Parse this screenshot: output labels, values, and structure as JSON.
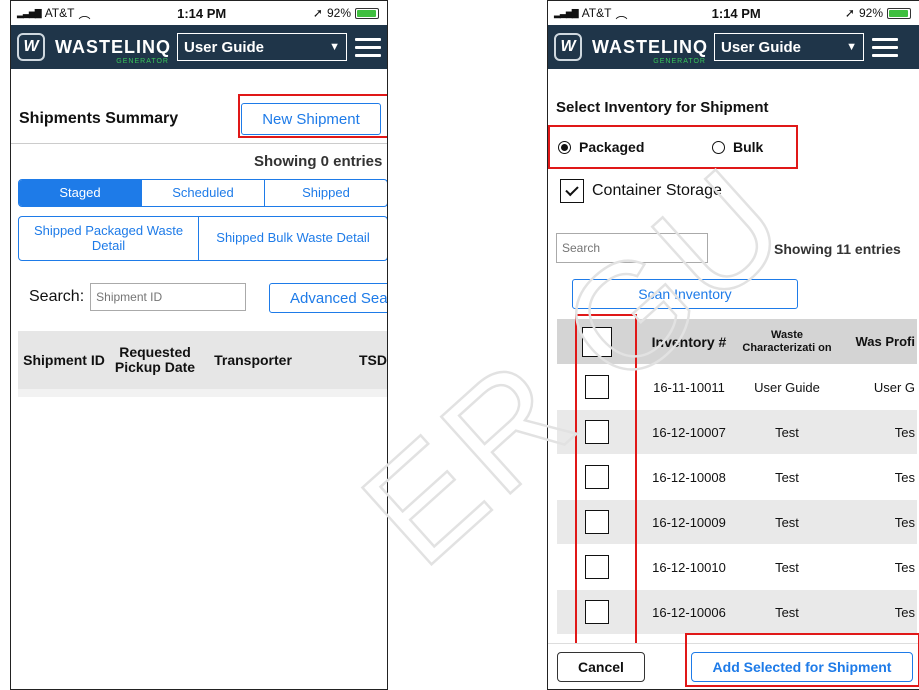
{
  "status_bar": {
    "carrier": "AT&T",
    "time": "1:14 PM",
    "battery": "92%"
  },
  "app_bar": {
    "logo": "W",
    "brand": "WASTELINQ",
    "brand_sub": "GENERATOR",
    "guide_select": "User Guide"
  },
  "left_screen": {
    "title": "Shipments Summary",
    "new_shipment_label": "New Shipment",
    "showing": "Showing 0 entries",
    "tabs": [
      {
        "label": "Staged",
        "active": true
      },
      {
        "label": "Scheduled",
        "active": false
      },
      {
        "label": "Shipped",
        "active": false
      }
    ],
    "detail_tabs": [
      {
        "label": "Shipped Packaged Waste Detail"
      },
      {
        "label": "Shipped Bulk Waste Detail"
      }
    ],
    "search_label": "Search:",
    "search_placeholder": "Shipment ID",
    "advanced_search_label": "Advanced Sea",
    "columns": [
      "Shipment ID",
      "Requested Pickup Date",
      "Transporter",
      "TSD"
    ]
  },
  "right_screen": {
    "title": "Select Inventory for Shipment",
    "radio_packaged": "Packaged",
    "radio_bulk": "Bulk",
    "selected_type": "Packaged",
    "container_storage_label": "Container Storage",
    "container_storage_checked": true,
    "search_placeholder": "Search",
    "showing": "Showing 11 entries",
    "scan_inventory_label": "Scan Inventory",
    "columns": [
      "Inventory #",
      "Waste Characterizati on",
      "Was Profi"
    ],
    "rows": [
      {
        "inventory": "16-11-10011",
        "characterization": "User Guide",
        "profile": "User G"
      },
      {
        "inventory": "16-12-10007",
        "characterization": "Test",
        "profile": "Tes"
      },
      {
        "inventory": "16-12-10008",
        "characterization": "Test",
        "profile": "Tes"
      },
      {
        "inventory": "16-12-10009",
        "characterization": "Test",
        "profile": "Tes"
      },
      {
        "inventory": "16-12-10010",
        "characterization": "Test",
        "profile": "Tes"
      },
      {
        "inventory": "16-12-10006",
        "characterization": "Test",
        "profile": "Tes"
      }
    ],
    "cancel_label": "Cancel",
    "add_selected_label": "Add Selected for Shipment"
  },
  "colors": {
    "app_bar": "#1f3549",
    "accent": "#1e7be8",
    "highlight": "#e01818",
    "brand_sub": "#38c45a"
  }
}
